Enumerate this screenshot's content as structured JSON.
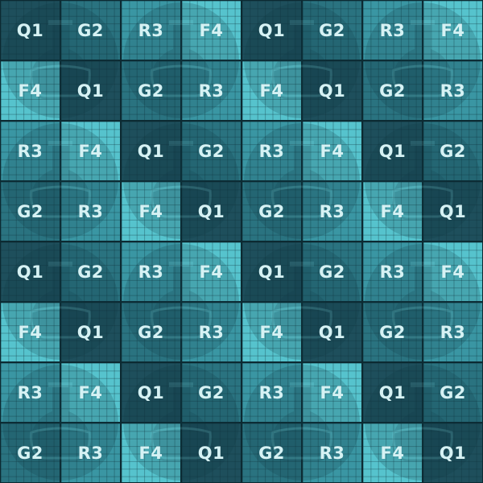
{
  "board": {
    "rows": 8,
    "cols": 8,
    "tiles": [
      [
        "Q1",
        "G2",
        "R3",
        "F4",
        "Q1",
        "G2",
        "R3",
        "F4"
      ],
      [
        "F4",
        "Q1",
        "G2",
        "R3",
        "F4",
        "Q1",
        "G2",
        "R3"
      ],
      [
        "R3",
        "F4",
        "Q1",
        "G2",
        "R3",
        "F4",
        "Q1",
        "G2"
      ],
      [
        "G2",
        "R3",
        "F4",
        "Q1",
        "G2",
        "R3",
        "F4",
        "Q1"
      ],
      [
        "Q1",
        "G2",
        "R3",
        "F4",
        "Q1",
        "G2",
        "R3",
        "F4"
      ],
      [
        "F4",
        "Q1",
        "G2",
        "R3",
        "F4",
        "Q1",
        "G2",
        "R3"
      ],
      [
        "R3",
        "F4",
        "Q1",
        "G2",
        "R3",
        "F4",
        "Q1",
        "G2"
      ],
      [
        "G2",
        "R3",
        "F4",
        "Q1",
        "G2",
        "R3",
        "F4",
        "Q1"
      ]
    ]
  },
  "colors": {
    "Q1": "#1e4f5c",
    "G2": "#2a7380",
    "R3": "#3a96a3",
    "F4": "#56c3cd",
    "grid_line": "#0d2f38",
    "label": "#d6f2f4",
    "flask_icon": "#0f3742"
  },
  "icons": {
    "watermark": "flask-icon"
  }
}
